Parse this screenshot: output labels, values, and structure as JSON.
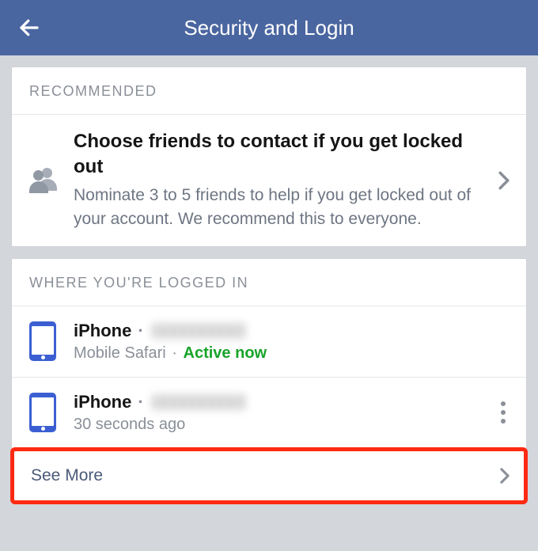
{
  "header": {
    "title": "Security and Login"
  },
  "recommended": {
    "section_label": "RECOMMENDED",
    "item": {
      "title": "Choose friends to contact if you get locked out",
      "desc": "Nominate 3 to 5 friends to help if you get locked out of your account. We recommend this to everyone."
    }
  },
  "sessions": {
    "section_label": "WHERE YOU'RE LOGGED IN",
    "items": [
      {
        "device": "iPhone",
        "separator": "·",
        "browser": "Mobile Safari",
        "status_separator": "·",
        "status": "Active now",
        "active": true
      },
      {
        "device": "iPhone",
        "separator": "·",
        "time": "30 seconds ago",
        "active": false
      }
    ],
    "see_more_label": "See More"
  }
}
